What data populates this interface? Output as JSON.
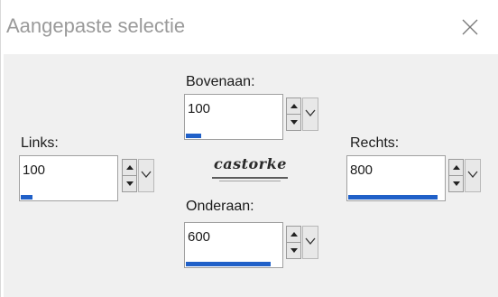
{
  "window": {
    "title": "Aangepaste selectie",
    "close_icon": "close-icon"
  },
  "fields": {
    "top": {
      "label": "Bovenaan:",
      "value": "100",
      "progress": 0.16
    },
    "left": {
      "label": "Links:",
      "value": "100",
      "progress": 0.12
    },
    "right": {
      "label": "Rechts:",
      "value": "800",
      "progress": 0.93
    },
    "bottom": {
      "label": "Onderaan:",
      "value": "600",
      "progress": 0.89
    }
  },
  "logo": {
    "text": "castorke"
  },
  "colors": {
    "progress": "#2060c8",
    "dialog_bg": "#f0f0f0",
    "title_text": "#9a9a9a"
  }
}
